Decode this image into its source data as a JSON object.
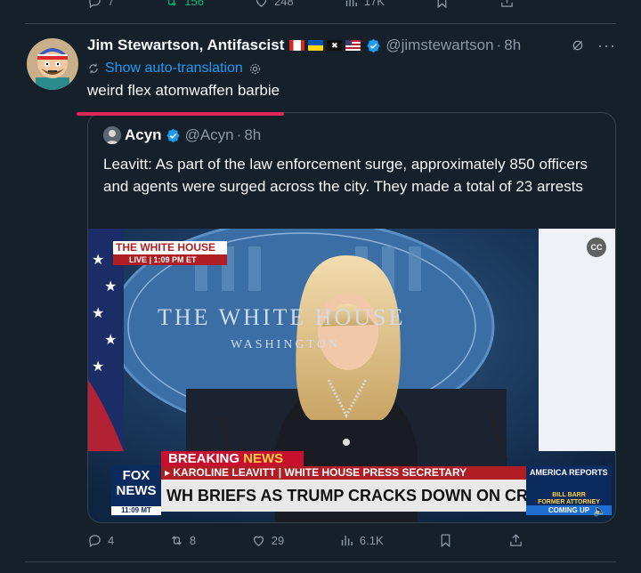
{
  "previous_tweet": {
    "actions": [
      {
        "icon": "reply-icon",
        "count": "7"
      },
      {
        "icon": "retweet-icon",
        "count": "156"
      },
      {
        "icon": "like-icon",
        "count": "248"
      },
      {
        "icon": "views-icon",
        "count": "17K"
      },
      {
        "icon": "bookmark-icon",
        "count": ""
      },
      {
        "icon": "share-icon",
        "count": ""
      }
    ]
  },
  "tweet": {
    "author_name": "Jim Stewartson, Antifascist",
    "handle": "@jimstewartson",
    "time": "8h",
    "translation_label": "Show auto-translation",
    "text": "weird flex atomwaffen barbie",
    "actions": {
      "replies": "4",
      "retweets": "8",
      "likes": "29",
      "views": "6.1K"
    }
  },
  "quote": {
    "author_name": "Acyn",
    "handle": "@Acyn",
    "time": "8h",
    "text": "Leavitt: As part of the law enforcement surge, approximately 850 officers and agents were surged across the city. They made a total of 23 arrests",
    "video": {
      "wh_tag_top": "THE WHITE HOUSE",
      "wh_tag_bottom": "LIVE  |  1:09 PM ET",
      "backdrop_text": "THE WHITE HOUSE",
      "backdrop_sub": "WASHINGTON",
      "breaking": "BREAKING",
      "breaking_news": "NEWS",
      "name_bar": "▸ KAROLINE LEAVITT  |  WHITE HOUSE PRESS SECRETARY",
      "headline": "WH BRIEFS AS TRUMP CRACKS DOWN ON CRIME IN DC",
      "fox_logo_1": "FOX",
      "fox_logo_2": "NEWS",
      "fox_time": "11:09 MT",
      "america_reports": "AMERICA REPORTS",
      "guest_name": "BILL BARR",
      "guest_title": "FORMER ATTORNEY GENERAL",
      "coming_up": "COMING UP",
      "cc_label": "CC"
    }
  },
  "colors": {
    "background": "#15202b",
    "accent": "#1d9bf0",
    "text_secondary": "#8b98a5",
    "red_underline": "#e0245e"
  }
}
